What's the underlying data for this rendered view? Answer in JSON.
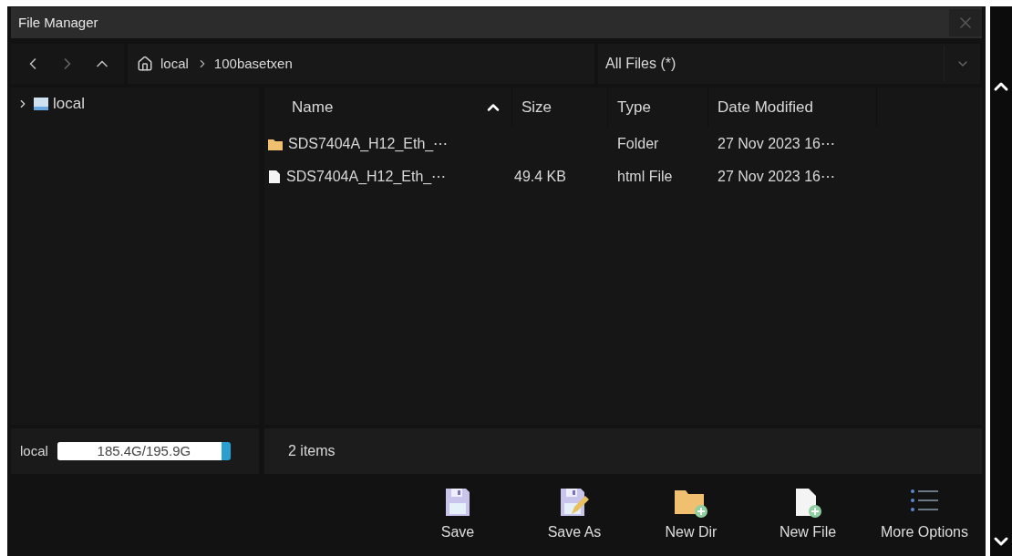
{
  "window": {
    "title": "File Manager"
  },
  "path": {
    "segments": [
      "local",
      "100basetxen"
    ]
  },
  "filter": {
    "value": "All Files (*)"
  },
  "tree": [
    {
      "label": "local",
      "expanded": false
    }
  ],
  "storage": {
    "label": "local",
    "reading": "185.4G/195.9G",
    "level": 0.95
  },
  "table": {
    "columns": [
      {
        "label": "Name",
        "sorted": true
      },
      {
        "label": "Size",
        "sorted": false
      },
      {
        "label": "Type",
        "sorted": false
      },
      {
        "label": "Date Modified",
        "sorted": false
      }
    ],
    "rows": [
      {
        "kind": "folder",
        "name": "SDS7404A_H12_Eth_⋯",
        "size": "",
        "type": "Folder",
        "date": "27 Nov 2023 16⋯"
      },
      {
        "kind": "file",
        "name": "SDS7404A_H12_Eth_⋯",
        "size": "49.4 KB",
        "type": "html File",
        "date": "27 Nov 2023 16⋯"
      }
    ]
  },
  "status_bar": {
    "text": "2 items"
  },
  "toolbar": [
    {
      "kind": "save",
      "label": "Save"
    },
    {
      "kind": "saveas",
      "label": "Save As"
    },
    {
      "kind": "newdir",
      "label": "New Dir"
    },
    {
      "kind": "newfile",
      "label": "New File"
    },
    {
      "kind": "more",
      "label": "More Options"
    }
  ]
}
